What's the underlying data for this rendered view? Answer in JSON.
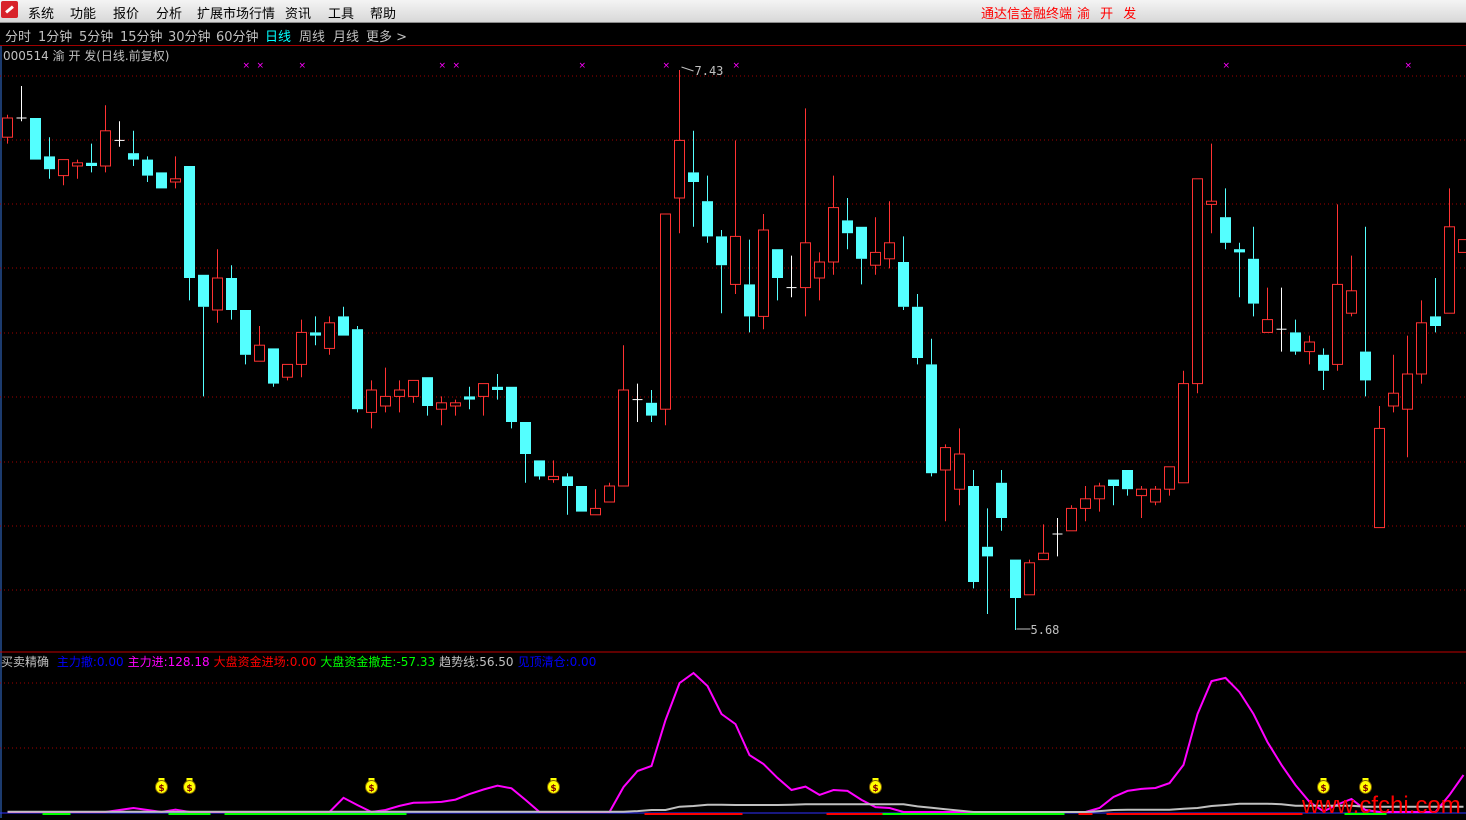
{
  "menu": {
    "items": [
      "系统",
      "功能",
      "报价",
      "分析",
      "扩展市场行情",
      "资讯",
      "工具",
      "帮助"
    ],
    "brand": "通达信金融终端",
    "stock_name": "渝 开 发"
  },
  "periods": {
    "items": [
      "分时",
      "1分钟",
      "5分钟",
      "15分钟",
      "30分钟",
      "60分钟",
      "日线",
      "周线",
      "月线",
      "更多 >"
    ],
    "active": "日线"
  },
  "chart": {
    "title": "000514 渝 开 发(日线.前复权)",
    "high_label": "7.43",
    "low_label": "5.68"
  },
  "indicator": {
    "name": "买卖精确",
    "fields": [
      {
        "label": "主力撤:",
        "value": "0.00",
        "color": "#0000ff"
      },
      {
        "label": "主力进:",
        "value": "128.18",
        "color": "#ff00ff"
      },
      {
        "label": "大盘资金进场:",
        "value": "0.00",
        "color": "#ff0000"
      },
      {
        "label": "大盘资金撤走:",
        "value": "-57.33",
        "color": "#00ff00"
      },
      {
        "label": "趋势线:",
        "value": "56.50",
        "color": "#c0c0c0"
      },
      {
        "label": "见顶清仓:",
        "value": "0.00",
        "color": "#0000ff"
      }
    ]
  },
  "watermark": "www.cfchi.com",
  "colors": {
    "up": "#ff3232",
    "down": "#54ffff",
    "flat": "#ffffff",
    "grid": "#a00000",
    "marker": "#ff00ff",
    "money_bag": "#ffff00"
  },
  "chart_data": {
    "type": "candlestick",
    "period": "daily",
    "price_range": [
      5.68,
      7.43
    ],
    "grid": true,
    "candles_ohlc": [
      [
        7.22,
        7.29,
        7.2,
        7.28
      ],
      [
        7.28,
        7.38,
        7.27,
        7.28
      ],
      [
        7.28,
        7.28,
        7.15,
        7.15
      ],
      [
        7.16,
        7.22,
        7.09,
        7.12
      ],
      [
        7.1,
        7.15,
        7.07,
        7.15
      ],
      [
        7.13,
        7.15,
        7.09,
        7.14
      ],
      [
        7.14,
        7.2,
        7.11,
        7.13
      ],
      [
        7.13,
        7.32,
        7.11,
        7.24
      ],
      [
        7.21,
        7.27,
        7.19,
        7.21
      ],
      [
        7.17,
        7.24,
        7.13,
        7.15
      ],
      [
        7.15,
        7.16,
        7.08,
        7.1
      ],
      [
        7.11,
        7.11,
        7.06,
        7.06
      ],
      [
        7.08,
        7.16,
        7.06,
        7.09
      ],
      [
        7.13,
        7.13,
        6.71,
        6.78
      ],
      [
        6.79,
        6.79,
        6.41,
        6.69
      ],
      [
        6.68,
        6.87,
        6.64,
        6.78
      ],
      [
        6.78,
        6.82,
        6.65,
        6.68
      ],
      [
        6.68,
        6.68,
        6.51,
        6.54
      ],
      [
        6.52,
        6.63,
        6.52,
        6.57
      ],
      [
        6.56,
        6.56,
        6.44,
        6.45
      ],
      [
        6.47,
        6.51,
        6.46,
        6.51
      ],
      [
        6.51,
        6.65,
        6.47,
        6.61
      ],
      [
        6.61,
        6.66,
        6.57,
        6.6
      ],
      [
        6.56,
        6.66,
        6.54,
        6.64
      ],
      [
        6.66,
        6.69,
        6.6,
        6.6
      ],
      [
        6.62,
        6.63,
        6.36,
        6.37
      ],
      [
        6.36,
        6.46,
        6.31,
        6.43
      ],
      [
        6.38,
        6.5,
        6.36,
        6.41
      ],
      [
        6.41,
        6.46,
        6.36,
        6.43
      ],
      [
        6.41,
        6.46,
        6.39,
        6.46
      ],
      [
        6.47,
        6.47,
        6.35,
        6.38
      ],
      [
        6.37,
        6.41,
        6.32,
        6.39
      ],
      [
        6.38,
        6.4,
        6.35,
        6.39
      ],
      [
        6.41,
        6.44,
        6.37,
        6.4
      ],
      [
        6.41,
        6.45,
        6.35,
        6.45
      ],
      [
        6.44,
        6.48,
        6.4,
        6.43
      ],
      [
        6.44,
        6.44,
        6.31,
        6.33
      ],
      [
        6.33,
        6.33,
        6.14,
        6.23
      ],
      [
        6.21,
        6.21,
        6.15,
        6.16
      ],
      [
        6.15,
        6.21,
        6.14,
        6.16
      ],
      [
        6.16,
        6.17,
        6.04,
        6.13
      ],
      [
        6.13,
        6.13,
        6.05,
        6.05
      ],
      [
        6.04,
        6.12,
        6.04,
        6.06
      ],
      [
        6.08,
        6.14,
        6.08,
        6.13
      ],
      [
        6.13,
        6.57,
        6.13,
        6.43
      ],
      [
        6.4,
        6.45,
        6.33,
        6.4
      ],
      [
        6.39,
        6.43,
        6.33,
        6.35
      ],
      [
        6.37,
        6.98,
        6.32,
        6.98
      ],
      [
        7.03,
        7.43,
        6.92,
        7.21
      ],
      [
        7.11,
        7.24,
        6.94,
        7.08
      ],
      [
        7.02,
        7.1,
        6.89,
        6.91
      ],
      [
        6.91,
        6.93,
        6.67,
        6.82
      ],
      [
        6.76,
        7.21,
        6.73,
        6.91
      ],
      [
        6.76,
        6.9,
        6.61,
        6.66
      ],
      [
        6.66,
        6.98,
        6.62,
        6.93
      ],
      [
        6.87,
        6.87,
        6.71,
        6.78
      ],
      [
        6.75,
        6.85,
        6.72,
        6.75
      ],
      [
        6.75,
        7.31,
        6.66,
        6.89
      ],
      [
        6.78,
        6.86,
        6.71,
        6.83
      ],
      [
        6.83,
        7.1,
        6.79,
        7.0
      ],
      [
        6.96,
        7.03,
        6.87,
        6.92
      ],
      [
        6.94,
        6.94,
        6.76,
        6.84
      ],
      [
        6.82,
        6.97,
        6.79,
        6.86
      ],
      [
        6.84,
        7.02,
        6.81,
        6.89
      ],
      [
        6.83,
        6.91,
        6.68,
        6.69
      ],
      [
        6.69,
        6.73,
        6.51,
        6.53
      ],
      [
        6.51,
        6.59,
        6.16,
        6.17
      ],
      [
        6.18,
        6.26,
        6.02,
        6.25
      ],
      [
        6.12,
        6.31,
        6.07,
        6.23
      ],
      [
        6.13,
        6.18,
        5.81,
        5.83
      ],
      [
        5.94,
        6.06,
        5.73,
        5.91
      ],
      [
        6.14,
        6.18,
        5.99,
        6.03
      ],
      [
        5.9,
        5.9,
        5.68,
        5.78
      ],
      [
        5.79,
        5.9,
        5.79,
        5.89
      ],
      [
        5.9,
        6.01,
        5.9,
        5.92
      ],
      [
        5.98,
        6.03,
        5.91,
        5.98
      ],
      [
        5.99,
        6.07,
        5.99,
        6.06
      ],
      [
        6.06,
        6.13,
        6.02,
        6.09
      ],
      [
        6.09,
        6.14,
        6.05,
        6.13
      ],
      [
        6.15,
        6.15,
        6.07,
        6.13
      ],
      [
        6.18,
        6.18,
        6.1,
        6.12
      ],
      [
        6.1,
        6.13,
        6.03,
        6.12
      ],
      [
        6.08,
        6.13,
        6.07,
        6.12
      ],
      [
        6.12,
        6.19,
        6.1,
        6.19
      ],
      [
        6.14,
        6.49,
        6.14,
        6.45
      ],
      [
        6.45,
        7.09,
        6.42,
        7.09
      ],
      [
        7.01,
        7.2,
        6.92,
        7.02
      ],
      [
        6.97,
        7.06,
        6.87,
        6.89
      ],
      [
        6.87,
        6.89,
        6.72,
        6.86
      ],
      [
        6.84,
        6.94,
        6.66,
        6.7
      ],
      [
        6.61,
        6.75,
        6.61,
        6.65
      ],
      [
        6.62,
        6.75,
        6.55,
        6.62
      ],
      [
        6.61,
        6.65,
        6.54,
        6.55
      ],
      [
        6.55,
        6.6,
        6.51,
        6.58
      ],
      [
        6.54,
        6.56,
        6.43,
        6.49
      ],
      [
        6.51,
        7.01,
        6.49,
        6.76
      ],
      [
        6.67,
        6.85,
        6.66,
        6.74
      ],
      [
        6.55,
        6.94,
        6.41,
        6.46
      ],
      [
        6.0,
        6.38,
        6.0,
        6.31
      ],
      [
        6.38,
        6.54,
        6.36,
        6.42
      ],
      [
        6.37,
        6.6,
        6.22,
        6.48
      ],
      [
        6.48,
        6.71,
        6.45,
        6.64
      ],
      [
        6.66,
        6.78,
        6.61,
        6.63
      ],
      [
        6.67,
        7.06,
        6.67,
        6.94
      ],
      [
        6.86,
        6.9,
        6.86,
        6.9
      ]
    ],
    "signal_markers_candle_index": [
      18,
      19,
      22,
      32,
      33,
      42,
      48,
      53,
      88,
      101
    ],
    "high_point": {
      "candle_index": 49,
      "value": 7.43
    },
    "low_point": {
      "candle_index": 73,
      "value": 5.68
    },
    "indicator": {
      "series": [
        {
          "name": "主力进",
          "color": "#ff00ff",
          "values": [
            0,
            0,
            0,
            0,
            0,
            0,
            0,
            0,
            7,
            14,
            7,
            0,
            8,
            0,
            0,
            0,
            0,
            0,
            0,
            0,
            0,
            0,
            0,
            0,
            49,
            24,
            0,
            7,
            21,
            32,
            33,
            35,
            43,
            62,
            78,
            91,
            82,
            42,
            0,
            0,
            0,
            0,
            0,
            0,
            86,
            142,
            159,
            318,
            446,
            481,
            436,
            339,
            304,
            197,
            166,
            118,
            76,
            88,
            59,
            76,
            73,
            42,
            17,
            14,
            0,
            0,
            0,
            0,
            0,
            0,
            0,
            0,
            0,
            0,
            0,
            0,
            0,
            0,
            14,
            52,
            73,
            80,
            83,
            100,
            163,
            339,
            453,
            464,
            415,
            339,
            242,
            163,
            93,
            35,
            2,
            26,
            45,
            7,
            0,
            0,
            0,
            0,
            0,
            59,
            128.18
          ]
        },
        {
          "name": "趋势线",
          "color": "#c0c0c0",
          "values": [
            3,
            3,
            3,
            3,
            3,
            3,
            3,
            3,
            3,
            3,
            3,
            3,
            3,
            3,
            3,
            3,
            3,
            3,
            3,
            3,
            3,
            3,
            3,
            3,
            3,
            3,
            3,
            3,
            3,
            3,
            3,
            3,
            3,
            3,
            3,
            3,
            3,
            3,
            3,
            3,
            3,
            3,
            3,
            3,
            3,
            10,
            21,
            21,
            57,
            64,
            78,
            78,
            75,
            75,
            75,
            75,
            78,
            82,
            82,
            82,
            82,
            82,
            82,
            82,
            82,
            60,
            46,
            29,
            15,
            0,
            0,
            0,
            0,
            0,
            0,
            0,
            0,
            0,
            10,
            21,
            25,
            25,
            25,
            25,
            35,
            43,
            64,
            75,
            88,
            88,
            88,
            82,
            67,
            67,
            67,
            67,
            67,
            56.5,
            56.5,
            56.5,
            56.5,
            56.5,
            56.5,
            56.5,
            56.5
          ]
        }
      ],
      "money_bag_candle_index": [
        12,
        14,
        27,
        40,
        63,
        95,
        98
      ],
      "bottom_strips": [
        {
          "color": "#00ff00",
          "from": 4,
          "to": 5
        },
        {
          "color": "#00ff00",
          "from": 13,
          "to": 15
        },
        {
          "color": "#00ff00",
          "from": 17,
          "to": 29
        },
        {
          "color": "#ff0000",
          "from": 47,
          "to": 53
        },
        {
          "color": "#ff0000",
          "from": 60,
          "to": 63
        },
        {
          "color": "#00ff00",
          "from": 64,
          "to": 76
        },
        {
          "color": "#ff0000",
          "from": 78,
          "to": 78
        },
        {
          "color": "#ff0000",
          "from": 80,
          "to": 93
        },
        {
          "color": "#00ff00",
          "from": 97,
          "to": 99
        }
      ]
    }
  }
}
